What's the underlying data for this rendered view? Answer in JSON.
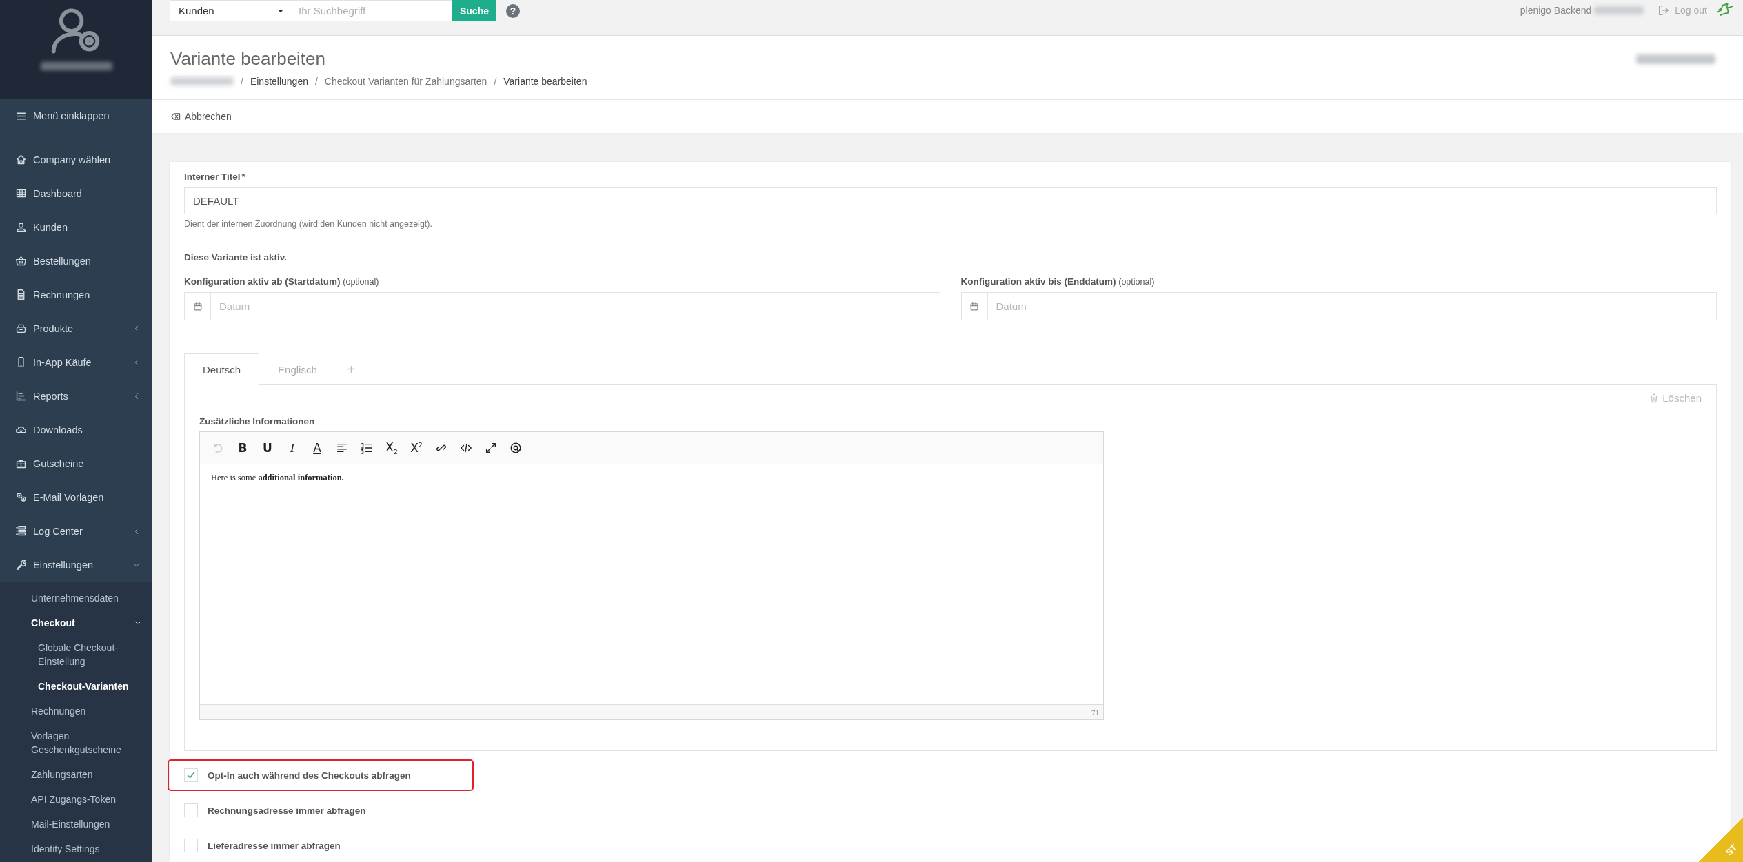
{
  "topbar": {
    "search_scope": "Kunden",
    "search_placeholder": "Ihr Suchbegriff",
    "search_button": "Suche",
    "help": "?",
    "app_label": "plenigo Backend",
    "logout": "Log out"
  },
  "sidebar": {
    "collapse": "Menü einklappen",
    "items": [
      {
        "label": "Company wählen"
      },
      {
        "label": "Dashboard"
      },
      {
        "label": "Kunden"
      },
      {
        "label": "Bestellungen"
      },
      {
        "label": "Rechnungen"
      },
      {
        "label": "Produkte",
        "expanded": false
      },
      {
        "label": "In-App Käufe",
        "expanded": false
      },
      {
        "label": "Reports",
        "expanded": false
      },
      {
        "label": "Downloads"
      },
      {
        "label": "Gutscheine"
      },
      {
        "label": "E-Mail Vorlagen"
      },
      {
        "label": "Log Center",
        "expanded": false
      },
      {
        "label": "Einstellungen",
        "expanded": true,
        "children": [
          {
            "label": "Unternehmensdaten",
            "selected": false
          },
          {
            "label": "Checkout",
            "selected": false,
            "expanded": true,
            "children": [
              {
                "label": "Globale Checkout-Einstellung",
                "selected": false
              },
              {
                "label": "Checkout-Varianten",
                "selected": true
              }
            ]
          },
          {
            "label": "Rechnungen",
            "selected": false
          },
          {
            "label": "Vorlagen Geschenkgutscheine",
            "selected": false
          },
          {
            "label": "Zahlungsarten",
            "selected": false
          },
          {
            "label": "API Zugangs-Token",
            "selected": false
          },
          {
            "label": "Mail-Einstellungen",
            "selected": false
          },
          {
            "label": "Identity Settings",
            "selected": false
          }
        ]
      }
    ]
  },
  "header": {
    "title": "Variante bearbeiten",
    "breadcrumb": [
      {
        "separator": "/",
        "label": "Einstellungen"
      },
      {
        "separator": "/",
        "label": "Checkout Varianten für Zahlungsarten"
      },
      {
        "separator": "/",
        "label": "Variante bearbeiten"
      }
    ],
    "cancel": "Abbrechen"
  },
  "form": {
    "title_label": "Interner Titel",
    "required_mark": "*",
    "title_value": "DEFAULT",
    "title_help": "Dient der internen Zuordnung (wird den Kunden nicht angezeigt).",
    "active_note": "Diese Variante ist aktiv.",
    "dates": [
      {
        "label": "Konfiguration aktiv ab (Startdatum)",
        "hint": "(optional)",
        "placeholder": "Datum"
      },
      {
        "label": "Konfiguration aktiv bis (Enddatum)",
        "hint": "(optional)",
        "placeholder": "Datum"
      }
    ],
    "language_tabs": [
      {
        "label": "Deutsch",
        "selected": true
      },
      {
        "label": "Englisch",
        "selected": false
      }
    ],
    "add_tab": "+",
    "delete": "Löschen",
    "editor": {
      "label": "Zusätzliche Informationen",
      "toolbar": [
        {
          "kind": "undo",
          "disabled": true
        },
        {
          "kind": "glyph",
          "glyph": "B",
          "disabled": false
        },
        {
          "kind": "glyph",
          "glyph": "U",
          "disabled": false
        },
        {
          "kind": "glyph",
          "glyph": "I",
          "disabled": false
        },
        {
          "kind": "glyph",
          "glyph": "A",
          "disabled": false
        },
        {
          "kind": "align",
          "disabled": false
        },
        {
          "kind": "list",
          "disabled": false
        },
        {
          "kind": "glyph",
          "glyph": "X$_{2}$",
          "disabled": false
        },
        {
          "kind": "glyph",
          "glyph": "X$^{2}$",
          "disabled": false
        },
        {
          "kind": "link",
          "disabled": false
        },
        {
          "kind": "code",
          "disabled": false
        },
        {
          "kind": "expand",
          "disabled": false
        },
        {
          "kind": "at",
          "disabled": false
        }
      ],
      "content": "Here is some **additional information.**",
      "char_count": "71"
    },
    "checkboxes": [
      {
        "label": "Opt-In auch während des Checkouts abfragen",
        "checked": true,
        "highlighted": true
      },
      {
        "label": "Rechnungsadresse immer abfragen",
        "checked": false,
        "highlighted": false
      },
      {
        "label": "Lieferadresse immer abfragen",
        "checked": false,
        "highlighted": false
      }
    ]
  },
  "ribbon": "ST"
}
